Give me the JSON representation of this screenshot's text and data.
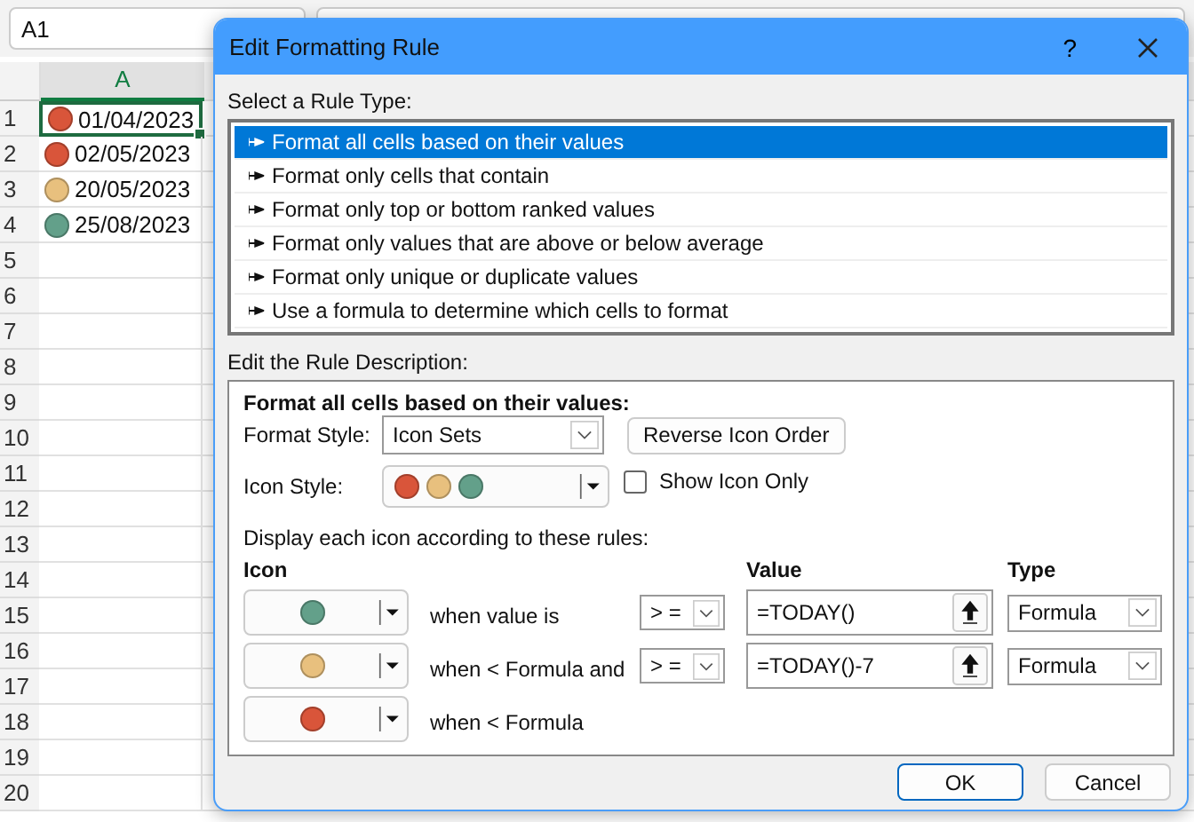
{
  "name_box": "A1",
  "column_header": "A",
  "rows": [
    {
      "number": "1",
      "color": "#d9553a",
      "value": "01/04/2023",
      "selected": true
    },
    {
      "number": "2",
      "color": "#d9553a",
      "value": "02/05/2023",
      "selected": false
    },
    {
      "number": "3",
      "color": "#e8c07e",
      "value": "20/05/2023",
      "selected": false
    },
    {
      "number": "4",
      "color": "#63a08a",
      "value": "25/08/2023",
      "selected": false
    },
    {
      "number": "5",
      "selected": false
    },
    {
      "number": "6",
      "selected": false
    },
    {
      "number": "7",
      "selected": false
    },
    {
      "number": "8",
      "selected": false
    },
    {
      "number": "9",
      "selected": false
    },
    {
      "number": "10",
      "selected": false
    },
    {
      "number": "11",
      "selected": false
    },
    {
      "number": "12",
      "selected": false
    },
    {
      "number": "13",
      "selected": false
    },
    {
      "number": "14",
      "selected": false
    },
    {
      "number": "15",
      "selected": false
    },
    {
      "number": "16",
      "selected": false
    },
    {
      "number": "17",
      "selected": false
    },
    {
      "number": "18",
      "selected": false
    },
    {
      "number": "19",
      "selected": false
    },
    {
      "number": "20",
      "selected": false
    }
  ],
  "dialog": {
    "title": "Edit Formatting Rule",
    "help": "?",
    "rule_type_label": "Select a Rule Type:",
    "rule_types": [
      {
        "label": "Format all cells based on their values",
        "selected": true
      },
      {
        "label": "Format only cells that contain",
        "selected": false
      },
      {
        "label": "Format only top or bottom ranked values",
        "selected": false
      },
      {
        "label": "Format only values that are above or below average",
        "selected": false
      },
      {
        "label": "Format only unique or duplicate values",
        "selected": false
      },
      {
        "label": "Use a formula to determine which cells to format",
        "selected": false
      }
    ],
    "description_label": "Edit the Rule Description:",
    "description_heading": "Format all cells based on their values:",
    "format_style": {
      "label": "Format Style:",
      "value": "Icon Sets"
    },
    "reverse_button": "Reverse Icon Order",
    "icon_style": {
      "label": "Icon Style:",
      "icons": [
        {
          "color": "#d9553a"
        },
        {
          "color": "#e8c07e"
        },
        {
          "color": "#63a08a"
        }
      ]
    },
    "show_icon_only": {
      "label": "Show Icon Only",
      "checked": false
    },
    "rules_intro": "Display each icon according to these rules:",
    "columns": {
      "icon": "Icon",
      "value": "Value",
      "type": "Type"
    },
    "icon_rules": [
      {
        "color": "#63a08a",
        "condition": "when value is",
        "operator": "> =",
        "value": "=TODAY()",
        "type": "Formula"
      },
      {
        "color": "#e8c07e",
        "condition": "when < Formula and",
        "operator": "> =",
        "value": "=TODAY()-7",
        "type": "Formula"
      },
      {
        "color": "#d9553a",
        "condition": "when < Formula"
      }
    ],
    "buttons": [
      {
        "label": "OK",
        "kind": "primary"
      },
      {
        "label": "Cancel",
        "kind": "secondary"
      }
    ]
  }
}
